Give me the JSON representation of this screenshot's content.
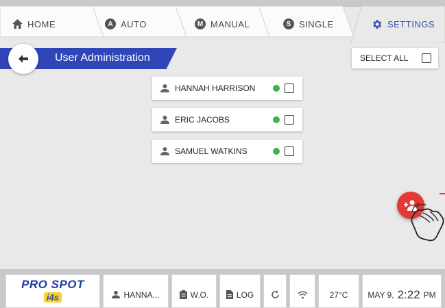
{
  "tabs": [
    {
      "label": "HOME",
      "icon": "home-icon",
      "active": false
    },
    {
      "label": "AUTO",
      "icon": "auto-mode-icon",
      "badge": "A",
      "active": false
    },
    {
      "label": "MANUAL",
      "icon": "manual-mode-icon",
      "badge": "M",
      "active": false
    },
    {
      "label": "SINGLE",
      "icon": "single-mode-icon",
      "badge": "S",
      "active": false
    },
    {
      "label": "SETTINGS",
      "icon": "gear-icon",
      "active": true
    }
  ],
  "header": {
    "title": "User Administration",
    "back_icon": "arrow-left-icon",
    "select_all_label": "SELECT ALL"
  },
  "users": [
    {
      "name": "HANNAH HARRISON",
      "status": "online",
      "checked": false
    },
    {
      "name": "ERIC JACOBS",
      "status": "online",
      "checked": false
    },
    {
      "name": "SAMUEL WATKINS",
      "status": "online",
      "checked": false
    }
  ],
  "fab": {
    "icon": "add-user-icon"
  },
  "statusbar": {
    "logo": {
      "brand": "PRO SPOT",
      "sub": "i4s"
    },
    "user": "HANNA...",
    "wo": "W.O.",
    "log": "LOG",
    "temperature": "27°C",
    "date": "MAY 9,",
    "time": "2:22",
    "ampm": "PM"
  },
  "colors": {
    "accent": "#2e46b8",
    "fab": "#e53935",
    "online": "#3bb54a",
    "background": "#e9e9e9"
  }
}
